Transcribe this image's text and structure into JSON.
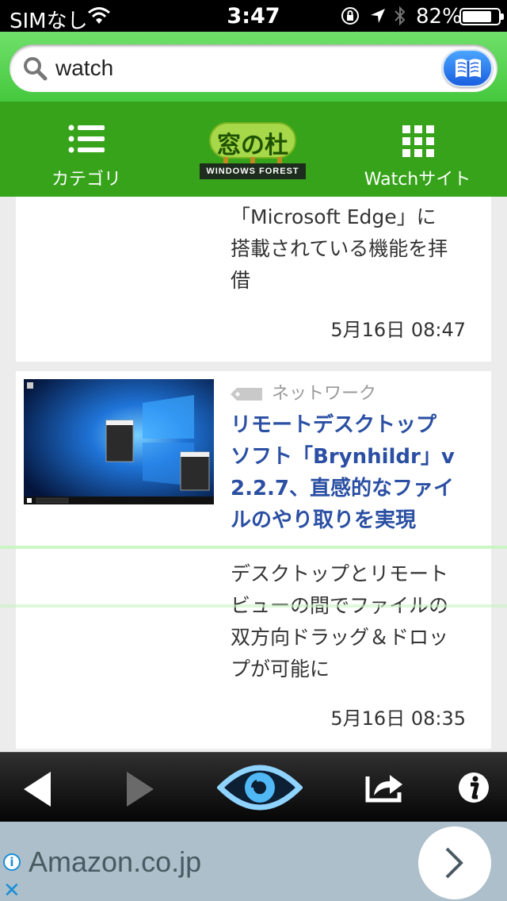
{
  "status_bar": {
    "carrier": "SIMなし",
    "time": "3:47",
    "battery_percent": "82%",
    "battery_level": 0.82
  },
  "search": {
    "value": "watch",
    "icon": "search-icon",
    "bookmark_icon": "bookmark-book-icon"
  },
  "nav": {
    "category_label": "カテゴリ",
    "logo_jp": "窓の杜",
    "logo_en": "WINDOWS FOREST",
    "watch_sites_label": "Watchサイト"
  },
  "articles": [
    {
      "excerpt_lines": [
        "「Microsoft Edge」に",
        "搭載されている機能を拝",
        "借"
      ],
      "date": "5月16日 08:47"
    },
    {
      "category": "ネットワーク",
      "title_lines": [
        "リモートデスクトップ",
        "ソフト「Brynhildr」v",
        "2.2.7、直感的なファイ",
        "ルのやり取りを実現"
      ],
      "excerpt_lines": [
        "デスクトップとリモート",
        "ビューの間でファイルの",
        "双方向ドラッグ＆ドロッ",
        "プが可能に"
      ],
      "date": "5月16日 08:35"
    }
  ],
  "toolbar": {
    "back_icon": "back-arrow-icon",
    "forward_icon": "forward-arrow-icon",
    "eye_icon": "eye-icon",
    "share_icon": "share-icon",
    "info_icon": "info-icon"
  },
  "ad": {
    "text": "Amazon.co.jp",
    "info_glyph": "i",
    "close_glyph": "✕"
  },
  "colors": {
    "header_green": "#36a31a",
    "title_blue": "#2a4fa3",
    "ad_background": "#acbfcb"
  }
}
